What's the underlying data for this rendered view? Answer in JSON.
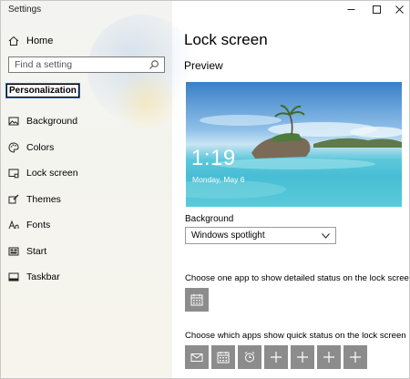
{
  "window": {
    "title": "Settings"
  },
  "sidebar": {
    "home_label": "Home",
    "search_placeholder": "Find a setting",
    "category": "Personalization",
    "items": [
      {
        "label": "Background",
        "icon": "picture-icon"
      },
      {
        "label": "Colors",
        "icon": "palette-icon"
      },
      {
        "label": "Lock screen",
        "icon": "lock-screen-icon"
      },
      {
        "label": "Themes",
        "icon": "brush-icon"
      },
      {
        "label": "Fonts",
        "icon": "font-icon"
      },
      {
        "label": "Start",
        "icon": "start-icon"
      },
      {
        "label": "Taskbar",
        "icon": "taskbar-icon"
      }
    ]
  },
  "main": {
    "title": "Lock screen",
    "preview_heading": "Preview",
    "preview": {
      "time": "1:19",
      "date": "Monday, May 6"
    },
    "background_label": "Background",
    "background_value": "Windows spotlight",
    "detailed_status_label": "Choose one app to show detailed status on the lock screen",
    "quick_status_label": "Choose which apps show quick status on the lock screen",
    "detailed_app_icon": "calendar-icon",
    "quick_apps": [
      "mail-icon",
      "calendar-icon",
      "alarm-icon",
      "add-icon",
      "add-icon",
      "add-icon",
      "add-icon"
    ]
  },
  "colors": {
    "tile": "#8c8c8c",
    "sidebar_bg": "#f3f4f1",
    "focus_outline": "#1f6fd0"
  }
}
